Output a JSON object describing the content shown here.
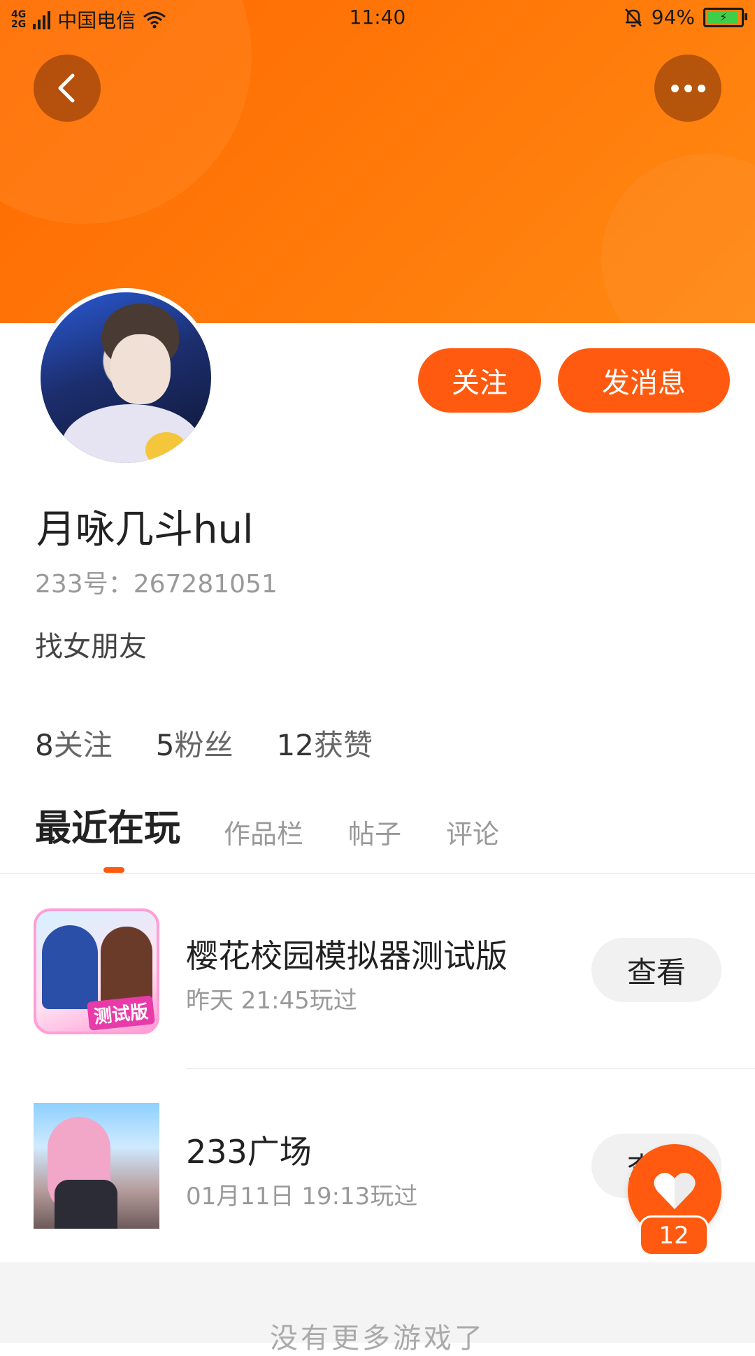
{
  "status_bar": {
    "network": "4G\n2G",
    "carrier": "中国电信",
    "time": "11:40",
    "battery": "94%"
  },
  "header": {
    "back_icon": "chevron-left-icon",
    "more_icon": "more-dots-icon",
    "banner_color": "#ff6a00"
  },
  "profile": {
    "name": "月咏几斗hul",
    "id_text": "233号：267281051",
    "bio": "找女朋友",
    "follow_label": "关注",
    "message_label": "发消息",
    "stats": [
      {
        "value": "8",
        "label": "关注"
      },
      {
        "value": "5",
        "label": "粉丝"
      },
      {
        "value": "12",
        "label": "获赞"
      }
    ]
  },
  "tabs": [
    {
      "label": "最近在玩",
      "active": true
    },
    {
      "label": "作品栏",
      "active": false
    },
    {
      "label": "帖子",
      "active": false
    },
    {
      "label": "评论",
      "active": false
    }
  ],
  "games": [
    {
      "title": "樱花校园模拟器测试版",
      "subtitle": "昨天 21:45玩过",
      "button": "查看",
      "badge": "测试版"
    },
    {
      "title": "233广场",
      "subtitle": "01月11日 19:13玩过",
      "button": "查看"
    }
  ],
  "footer": {
    "text": "没有更多游戏了"
  },
  "like_fab": {
    "count": "12",
    "icon": "heart-icon"
  },
  "accent_color": "#ff5a0f"
}
